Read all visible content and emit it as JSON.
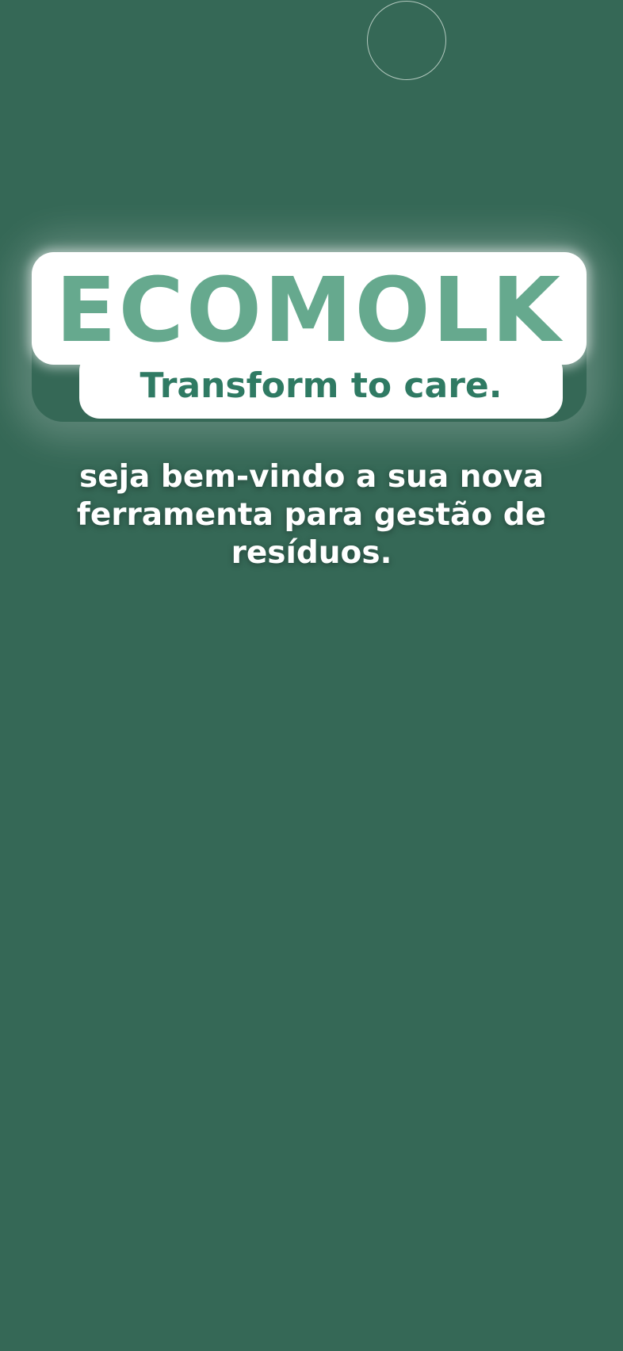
{
  "colors": {
    "background": "#356856",
    "logo_word": "#66a98e",
    "logo_tagline": "#2f7a63",
    "logo_panel": "#ffffff",
    "welcome_text": "#ffffff"
  },
  "logo": {
    "wordmark": "ECOMOLK",
    "tagline": "Transform to care."
  },
  "welcome": {
    "text": "seja bem-vindo a sua nova ferramenta para gestão de resíduos."
  }
}
